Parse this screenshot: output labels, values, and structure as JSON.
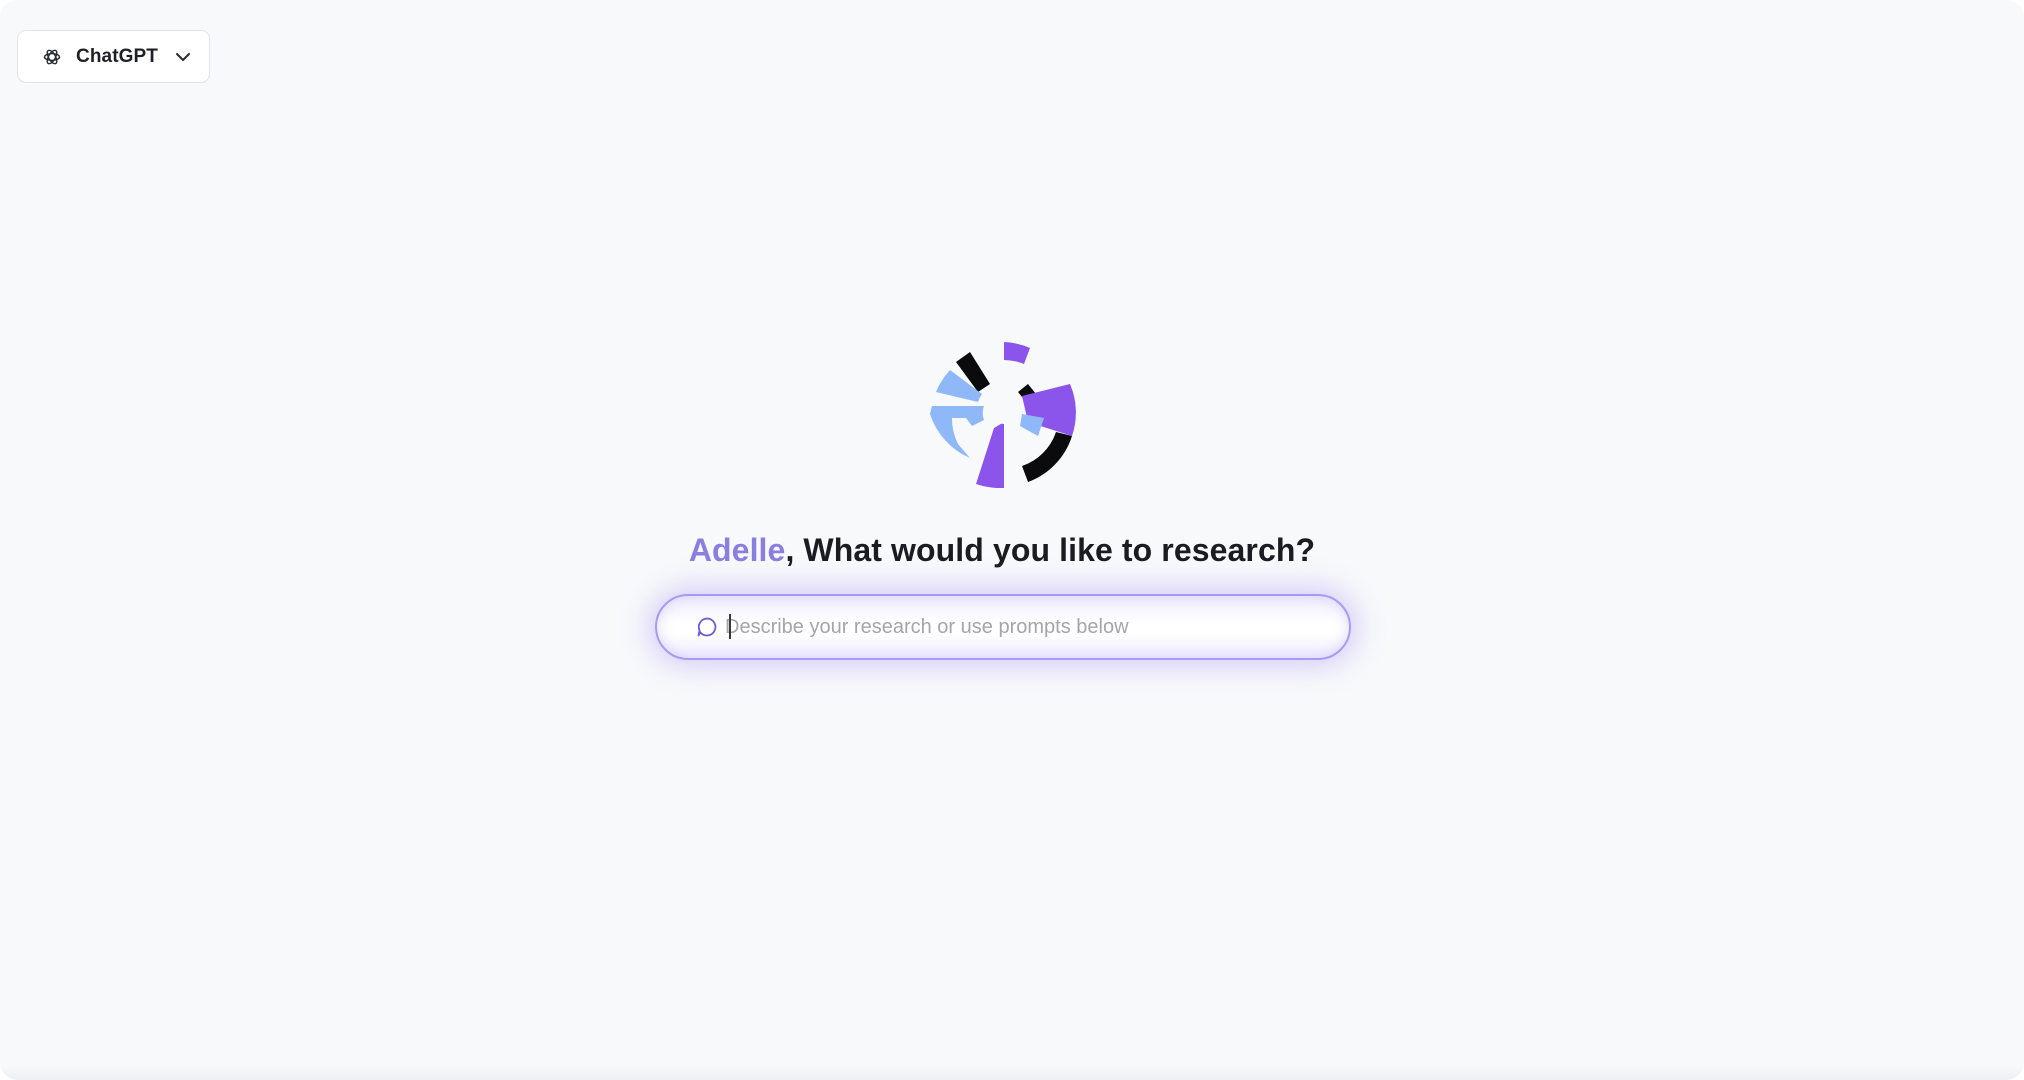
{
  "model_selector": {
    "label": "ChatGPT",
    "icon": "openai-icon",
    "chevron": "chevron-down-icon"
  },
  "greeting": {
    "name": "Adelle",
    "text": ", What would you like to research?"
  },
  "search": {
    "placeholder": "Describe your research or use prompts below",
    "value": "",
    "icon": "chat-bubble-icon"
  },
  "colors": {
    "accent": "#8a7fe0",
    "logo_purple": "#8b55ec",
    "logo_blue": "#8fb8f8",
    "logo_black": "#0b0b0d",
    "input_border": "#a79af2"
  }
}
